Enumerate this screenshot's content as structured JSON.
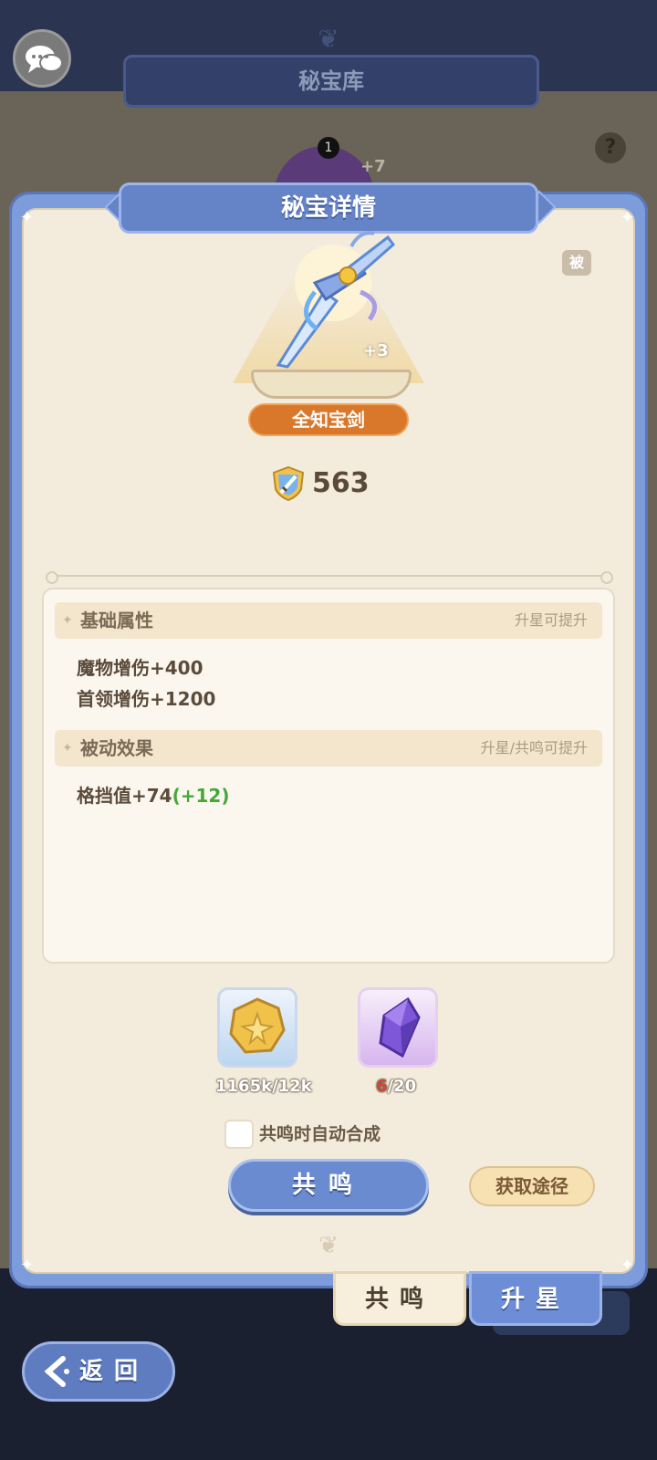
{
  "background": {
    "title": "秘宝库",
    "help": "?",
    "orb_badge": "1",
    "orb_plus": "+7"
  },
  "panel": {
    "title": "秘宝详情",
    "passive_badge": "被",
    "item": {
      "level": "+3",
      "name": "全知宝剑",
      "power": "563"
    },
    "sections": [
      {
        "title": "基础属性",
        "hint": "升星可提升",
        "lines": [
          "魔物增伤+400",
          "首领增伤+1200"
        ]
      },
      {
        "title": "被动效果",
        "hint": "升星/共鸣可提升",
        "lines": [
          {
            "text": "格挡值+74",
            "bonus": "(+12)"
          }
        ]
      }
    ],
    "materials": [
      {
        "icon": "gold-coin-icon",
        "have": "1165k",
        "need": "12k",
        "sufficient": true
      },
      {
        "icon": "purple-crystal-icon",
        "have": "6",
        "need": "20",
        "sufficient": false
      }
    ],
    "auto_synthesize_label": "共鸣时自动合成",
    "auto_synthesize_checked": false,
    "resonate_button": "共鸣",
    "source_button": "获取途径"
  },
  "tabs": [
    {
      "label": "共鸣",
      "active": false
    },
    {
      "label": "升星",
      "active": true
    }
  ],
  "back_button": "返回",
  "colors": {
    "accent_blue": "#6584c8",
    "name_plate_orange": "#d9782b",
    "bonus_green": "#45a73a",
    "insufficient_red": "#d04a3a"
  }
}
